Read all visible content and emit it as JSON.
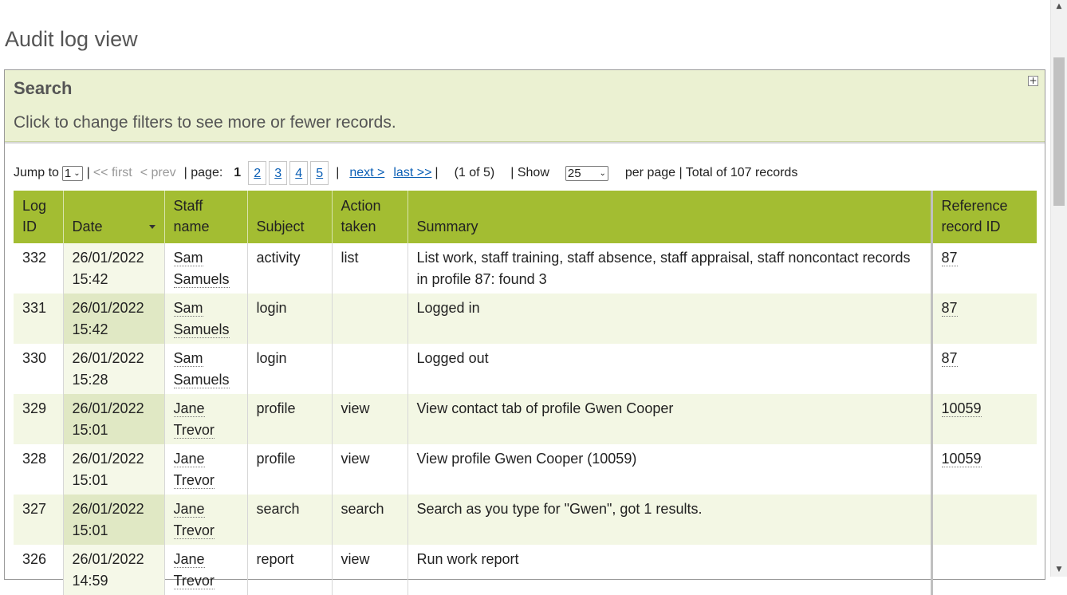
{
  "page": {
    "title": "Audit log view"
  },
  "search": {
    "title": "Search",
    "hint": "Click to change filters to see more or fewer records.",
    "expand_icon": "plus-square-icon"
  },
  "pager": {
    "jump_label": "Jump to",
    "jump_value": "1",
    "first": "<< first",
    "prev": "< prev",
    "page_label": "| page:",
    "current_page": "1",
    "pages": [
      "2",
      "3",
      "4",
      "5"
    ],
    "next": "next >",
    "last": "last >>",
    "position": "(1 of 5)",
    "show_label": "| Show",
    "show_value": "25",
    "per_page_label": "per page | Total of 107  records"
  },
  "table": {
    "headers": {
      "log_id": "Log ID",
      "date": "Date",
      "staff": "Staff name",
      "subject": "Subject",
      "action": "Action taken",
      "summary": "Summary",
      "reference": "Reference record ID"
    },
    "rows": [
      {
        "id": "332",
        "date": "26/01/2022 15:42",
        "staff": "Sam Samuels",
        "subject": "activity",
        "action": "list",
        "summary": "List work, staff training, staff absence, staff appraisal, staff noncontact records in profile 87: found 3",
        "ref": "87"
      },
      {
        "id": "331",
        "date": "26/01/2022 15:42",
        "staff": "Sam Samuels",
        "subject": "login",
        "action": "",
        "summary": "Logged in",
        "ref": "87"
      },
      {
        "id": "330",
        "date": "26/01/2022 15:28",
        "staff": "Sam Samuels",
        "subject": "login",
        "action": "",
        "summary": "Logged out",
        "ref": "87"
      },
      {
        "id": "329",
        "date": "26/01/2022 15:01",
        "staff": "Jane Trevor",
        "subject": "profile",
        "action": "view",
        "summary": "View contact tab of profile Gwen Cooper",
        "ref": "10059"
      },
      {
        "id": "328",
        "date": "26/01/2022 15:01",
        "staff": "Jane Trevor",
        "subject": "profile",
        "action": "view",
        "summary": "View profile Gwen Cooper (10059)",
        "ref": "10059"
      },
      {
        "id": "327",
        "date": "26/01/2022 15:01",
        "staff": "Jane Trevor",
        "subject": "search",
        "action": "search",
        "summary": "Search as you type for \"Gwen\", got 1 results.",
        "ref": ""
      },
      {
        "id": "326",
        "date": "26/01/2022 14:59",
        "staff": "Jane Trevor",
        "subject": "report",
        "action": "view",
        "summary": "Run work report",
        "ref": ""
      }
    ]
  },
  "colors": {
    "header_bg": "#a3bd32",
    "search_bg": "#ebf1d2",
    "alt_row": "#f3f7e4",
    "link": "#0b5fb5"
  }
}
